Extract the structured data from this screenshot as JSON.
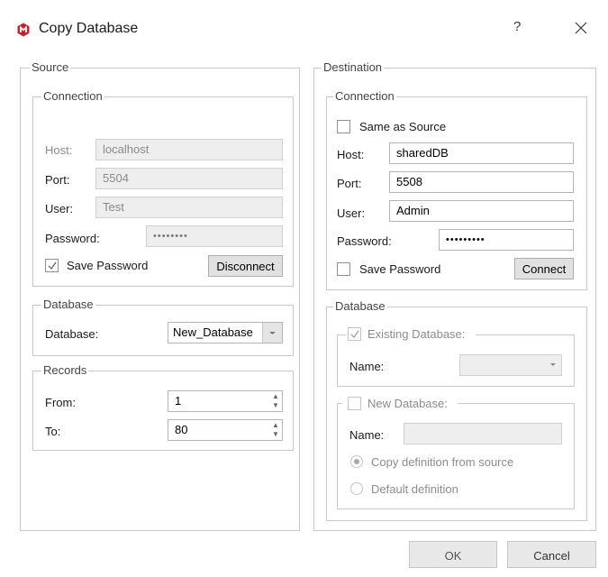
{
  "window": {
    "title": "Copy Database",
    "help": "?"
  },
  "source": {
    "legend": "Source",
    "connection": {
      "legend": "Connection",
      "host_label": "Host:",
      "host_value": "localhost",
      "port_label": "Port:",
      "port_value": "5504",
      "user_label": "User:",
      "user_value": "Test",
      "password_label": "Password:",
      "password_mask": "••••••••",
      "save_password_label": "Save Password",
      "save_password_checked": true,
      "disconnect_label": "Disconnect"
    },
    "database": {
      "legend": "Database",
      "label": "Database:",
      "value": "New_Database"
    },
    "records": {
      "legend": "Records",
      "from_label": "From:",
      "from_value": "1",
      "to_label": "To:",
      "to_value": "80"
    }
  },
  "destination": {
    "legend": "Destination",
    "connection": {
      "legend": "Connection",
      "same_as_source_label": "Same as Source",
      "same_as_source_checked": false,
      "host_label": "Host:",
      "host_value": "sharedDB",
      "port_label": "Port:",
      "port_value": "5508",
      "user_label": "User:",
      "user_value": "Admin",
      "password_label": "Password:",
      "password_mask": "•••••••••",
      "save_password_label": "Save Password",
      "save_password_checked": false,
      "connect_label": "Connect"
    },
    "database": {
      "legend": "Database",
      "existing_label": "Existing Database:",
      "existing_checked": true,
      "existing_name_label": "Name:",
      "existing_name_value": "",
      "new_label": "New Database:",
      "new_checked": false,
      "new_name_label": "Name:",
      "new_name_value": "",
      "copy_definition_label": "Copy definition from source",
      "copy_definition_selected": true,
      "default_definition_label": "Default definition",
      "default_definition_selected": false
    }
  },
  "footer": {
    "ok_label": "OK",
    "cancel_label": "Cancel"
  },
  "colors": {
    "app_icon": "#c8202b",
    "border": "#c8c8c8",
    "disabled_bg": "#eeeeee"
  }
}
